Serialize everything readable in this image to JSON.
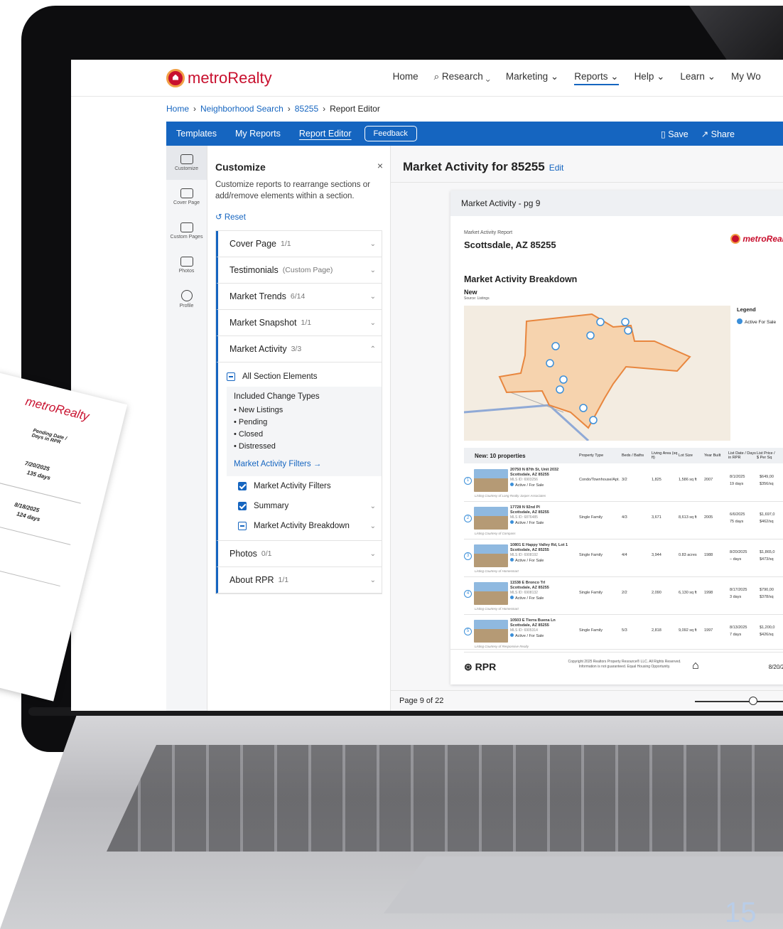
{
  "nav": {
    "logo": "metroRealty",
    "links": [
      "Home",
      "Research",
      "Marketing",
      "Reports",
      "Help",
      "Learn",
      "My Wo"
    ]
  },
  "breadcrumb": [
    "Home",
    "Neighborhood Search",
    "85255",
    "Report Editor"
  ],
  "toolbar": {
    "tabs": [
      "Templates",
      "My Reports",
      "Report Editor"
    ],
    "feedback": "Feedback",
    "save": "Save",
    "share": "Share"
  },
  "rail": [
    "Customize",
    "Cover Page",
    "Custom Pages",
    "Photos",
    "Profile"
  ],
  "customize": {
    "title": "Customize",
    "close": "×",
    "description": "Customize reports to rearrange sections or add/remove elements within a section.",
    "reset": "Reset",
    "sections": [
      {
        "name": "Cover Page",
        "count": "1/1"
      },
      {
        "name": "Testimonials",
        "count": "(Custom Page)"
      },
      {
        "name": "Market Trends",
        "count": "6/14"
      },
      {
        "name": "Market Snapshot",
        "count": "1/1"
      },
      {
        "name": "Market Activity",
        "count": "3/3"
      }
    ],
    "all_elements": "All Section Elements",
    "included_title": "Included Change Types",
    "change_types": [
      "• New Listings",
      "• Pending",
      "• Closed",
      "• Distressed"
    ],
    "filters_link": "Market Activity Filters →",
    "elements": [
      "Market Activity Filters",
      "Summary",
      "Market Activity Breakdown"
    ],
    "after_sections": [
      {
        "name": "Photos",
        "count": "0/1"
      },
      {
        "name": "About RPR",
        "count": "1/1"
      }
    ]
  },
  "preview": {
    "title": "Market Activity for 85255",
    "edit": "Edit",
    "card_title": "Market Activity - pg 9",
    "report_label": "Market Activity Report",
    "city": "Scottsdale, AZ 85255",
    "logo": "metroReal",
    "breakdown": "Market Activity Breakdown",
    "new_label": "New",
    "source": "Source: Listings",
    "legend_title": "Legend",
    "legend_item": "Active For Sale",
    "table_headers": [
      "New: 10 properties",
      "Property Type",
      "Beds / Baths",
      "Living Area (sq ft)",
      "Lot Size",
      "Year Built",
      "List Date / Days in RPR",
      "List Price / $ Per Sq"
    ],
    "rows": [
      {
        "n": "1",
        "addr1": "20750 N 87th St, Unit 2032",
        "addr2": "Scottsdale, AZ 85255",
        "mls": "MLS ID: 6903256",
        "status": "Active / For Sale",
        "courtesy": "Listing Courtesy of Long Realty Jasper Associates",
        "type": "Condo/Townhouse/Apt.",
        "beds": "3/2",
        "area": "1,825",
        "lot": "1,586 sq ft",
        "year": "2007",
        "date": "8/1/2025",
        "days": "19 days",
        "price": "$649,00",
        "ppsf": "$356/sq"
      },
      {
        "n": "2",
        "addr1": "17728 N 92nd Pl",
        "addr2": "Scottsdale, AZ 85255",
        "mls": "MLS ID: 6876485",
        "status": "Active / For Sale",
        "courtesy": "Listing Courtesy of Compass",
        "type": "Single Family",
        "beds": "4/3",
        "area": "3,671",
        "lot": "8,613 sq ft",
        "year": "2005",
        "date": "6/6/2025",
        "days": "75 days",
        "price": "$1,697,0",
        "ppsf": "$462/sq"
      },
      {
        "n": "3",
        "addr1": "10801 E Happy Valley Rd, Lot 1",
        "addr2": "Scottsdale, AZ 85255",
        "mls": "MLS ID: 6908192",
        "status": "Active / For Sale",
        "courtesy": "Listing Courtesy of Homesmart",
        "type": "Single Family",
        "beds": "4/4",
        "area": "3,944",
        "lot": "0.83 acres",
        "year": "1988",
        "date": "8/20/2025",
        "days": "– days",
        "price": "$1,865,0",
        "ppsf": "$473/sq"
      },
      {
        "n": "4",
        "addr1": "11538 E Bronco Trl",
        "addr2": "Scottsdale, AZ 85255",
        "mls": "MLS ID: 6908132",
        "status": "Active / For Sale",
        "courtesy": "Listing Courtesy of Homesmart",
        "type": "Single Family",
        "beds": "2/2",
        "area": "2,090",
        "lot": "6,130 sq ft",
        "year": "1998",
        "date": "8/17/2025",
        "days": "3 days",
        "price": "$790,00",
        "ppsf": "$378/sq"
      },
      {
        "n": "5",
        "addr1": "10503 E Tierra Buena Ln",
        "addr2": "Scottsdale, AZ 85255",
        "mls": "MLS ID: 6905314",
        "status": "Active / For Sale",
        "courtesy": "Listing Courtesy of Responsive Realty",
        "type": "Single Family",
        "beds": "5/3",
        "area": "2,818",
        "lot": "9,092 sq ft",
        "year": "1997",
        "date": "8/13/2025",
        "days": "7 days",
        "price": "$1,200,0",
        "ppsf": "$426/sq"
      }
    ],
    "footer_logo": "RPR",
    "copyright": "Copyright 2025 Realtors Property Resource® LLC. All Rights Reserved. Information is not guaranteed. Equal Housing Opportunity.",
    "footer_date": "8/20/2",
    "page_indicator": "Page 9 of 22"
  },
  "paper": {
    "logo": "metroRealty",
    "col1": "Pending Date / Days in RPR",
    "dates": [
      "7/20/2025",
      "135 days",
      "8/18/2025",
      "124 days"
    ]
  },
  "slide_number": "15"
}
